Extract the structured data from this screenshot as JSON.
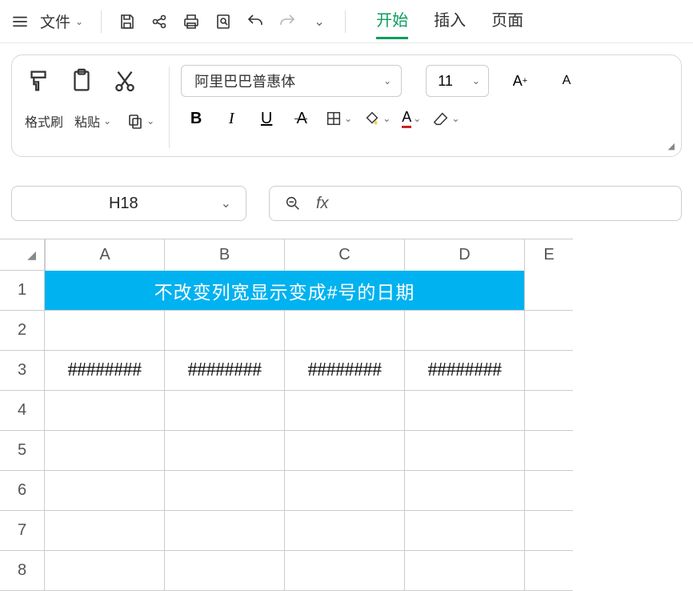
{
  "topbar": {
    "file_label": "文件"
  },
  "tabs": {
    "start": "开始",
    "insert": "插入",
    "page": "页面"
  },
  "ribbon": {
    "format_painter": "格式刷",
    "paste": "粘贴",
    "font_name": "阿里巴巴普惠体",
    "font_size": "11"
  },
  "namebox": {
    "cell_ref": "H18"
  },
  "formula_bar": {
    "fx": "fx",
    "value": ""
  },
  "grid": {
    "columns": [
      "A",
      "B",
      "C",
      "D",
      "E"
    ],
    "merged_title": "不改变列宽显示变成#号的日期",
    "hash_value": "########",
    "row_labels": [
      "1",
      "2",
      "3",
      "4",
      "5",
      "6",
      "7",
      "8"
    ]
  },
  "icons": {
    "chevron": "⌄"
  }
}
